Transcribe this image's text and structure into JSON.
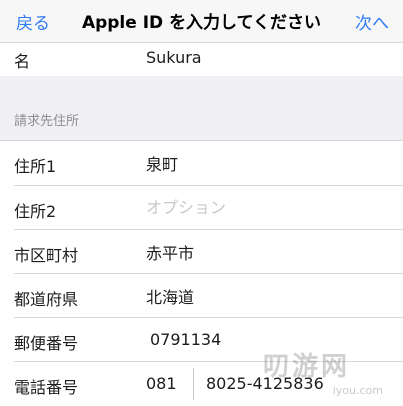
{
  "nav": {
    "back_label": "戻る",
    "title": "Apple ID を入力してください",
    "next_label": "次へ"
  },
  "name_row": {
    "label": "名",
    "value": "Sukura"
  },
  "billing": {
    "section_title": "請求先住所",
    "rows": [
      {
        "label": "住所1",
        "value": "泉町"
      },
      {
        "label": "住所2",
        "value": "",
        "placeholder": "オプション"
      },
      {
        "label": "市区町村",
        "value": "赤平市"
      },
      {
        "label": "都道府県",
        "value": "北海道"
      },
      {
        "label": "郵便番号",
        "value": "0791134"
      }
    ],
    "phone": {
      "label": "電話番号",
      "area_code": "081",
      "number": "8025-4125836"
    }
  },
  "watermark": {
    "text": "叨游网",
    "url": "iyou.com"
  },
  "colors": {
    "accent": "#2f7cf6",
    "group_bg": "#efeff4",
    "separator": "#d8d8dc",
    "placeholder": "#c7c7cc"
  }
}
